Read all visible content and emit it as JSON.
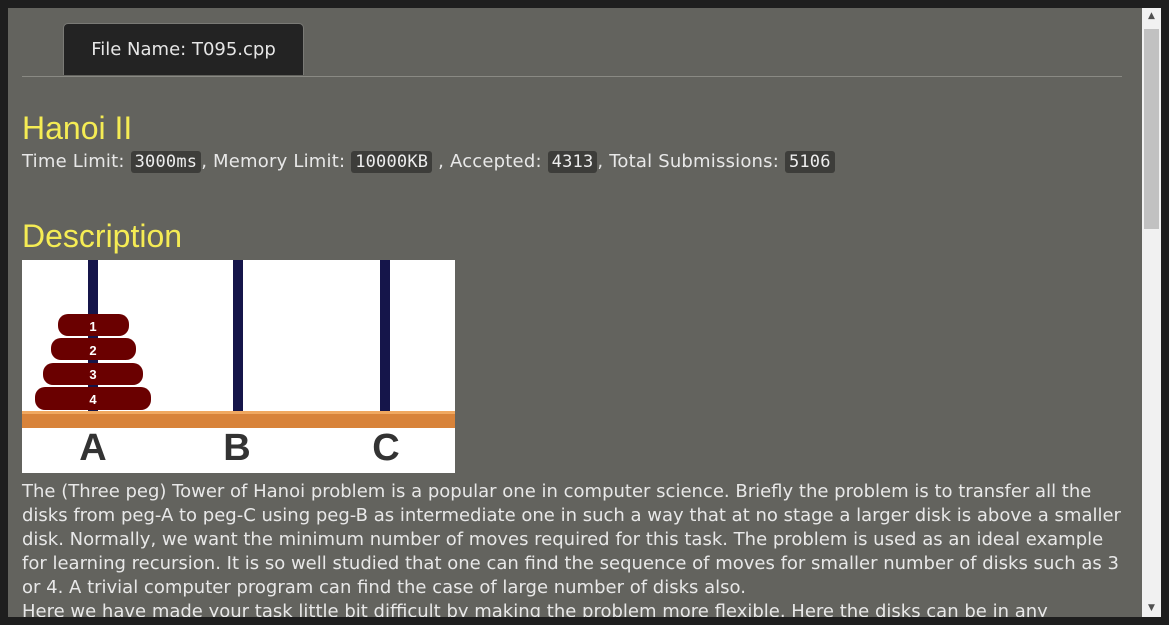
{
  "tab": {
    "label": "File Name:  T095.cpp"
  },
  "problem": {
    "title": "Hanoi II",
    "time_limit_label": "Time Limit:",
    "time_limit_value": "3000ms",
    "memory_limit_label": ", Memory Limit:",
    "memory_limit_value": "10000KB",
    "accepted_label": " , Accepted:",
    "accepted_value": "4313",
    "total_label": ", Total Submissions:",
    "total_value": "5106"
  },
  "description": {
    "heading": "Description",
    "figure": {
      "disk_labels": [
        "1",
        "2",
        "3",
        "4"
      ],
      "peg_labels": [
        "A",
        "B",
        "C"
      ]
    },
    "paragraph": "The (Three peg) Tower of Hanoi problem is a popular one in computer science. Briefly the problem is to transfer all the disks from peg-A to peg-C using peg-B as intermediate one in such a way that at no stage a larger disk is above a smaller disk. Normally, we want the minimum number of moves required for this task. The problem is used as an ideal example for learning recursion. It is so well studied that one can find the sequence of moves for smaller number of disks such as 3 or 4. A trivial computer program can find the case of large number of disks also.",
    "paragraph2": "Here we have made your task little bit difficult by making the problem more flexible. Here the disks can be in any"
  },
  "scrollbar": {
    "up_icon": "arrow-up-icon",
    "down_icon": "arrow-down-icon"
  },
  "colors": {
    "title": "#f5ec54",
    "background": "#63635e"
  }
}
